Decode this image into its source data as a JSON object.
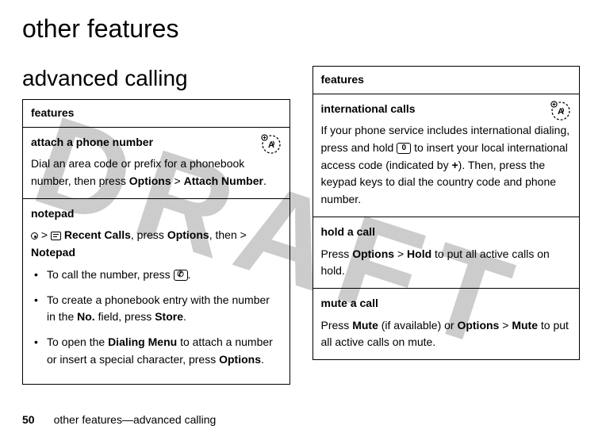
{
  "page_title": "other features",
  "section_title": "advanced calling",
  "watermark": "DRAFT",
  "footer": {
    "page_number": "50",
    "running_title": "other features—advanced calling"
  },
  "left": {
    "header": "features",
    "attach": {
      "title": "attach a phone number",
      "body_pre": "Dial an area code or prefix for a phonebook number, then press ",
      "options": "Options",
      "gt": " > ",
      "attach_num": "Attach Number",
      "period": "."
    },
    "notepad": {
      "title": "notepad",
      "gt1": " > ",
      "recent": "Recent Calls",
      "press": ", press ",
      "options": "Options",
      "then": ", then > ",
      "notepad": "Notepad",
      "b1_pre": "To call the number, press ",
      "b1_key": "✆",
      "b1_post": ".",
      "b2_pre": "To create a phonebook entry with the number in the ",
      "b2_no": "No.",
      "b2_mid": " field, press ",
      "b2_store": "Store",
      "b2_post": ".",
      "b3_pre": "To open the ",
      "b3_dm": "Dialing Menu",
      "b3_mid": " to attach a number or insert a special character, press ",
      "b3_opt": "Options",
      "b3_post": "."
    }
  },
  "right": {
    "header": "features",
    "intl": {
      "title": "international calls",
      "p1": "If your phone service includes international dialing, press and hold ",
      "key0": "0",
      "p2": " to insert your local international access code (indicated by ",
      "plus": "+",
      "p3": "). Then, press the keypad keys to dial the country code and phone number."
    },
    "hold": {
      "title": "hold a call",
      "pre": "Press ",
      "options": "Options",
      "gt": " > ",
      "hold": "Hold",
      "post": " to put all active calls on hold."
    },
    "mute": {
      "title": "mute a call",
      "pre": "Press ",
      "mute1": "Mute",
      "mid1": " (if available) or ",
      "options": "Options",
      "gt": " > ",
      "mute2": "Mute",
      "post": " to put all active calls on mute."
    }
  }
}
